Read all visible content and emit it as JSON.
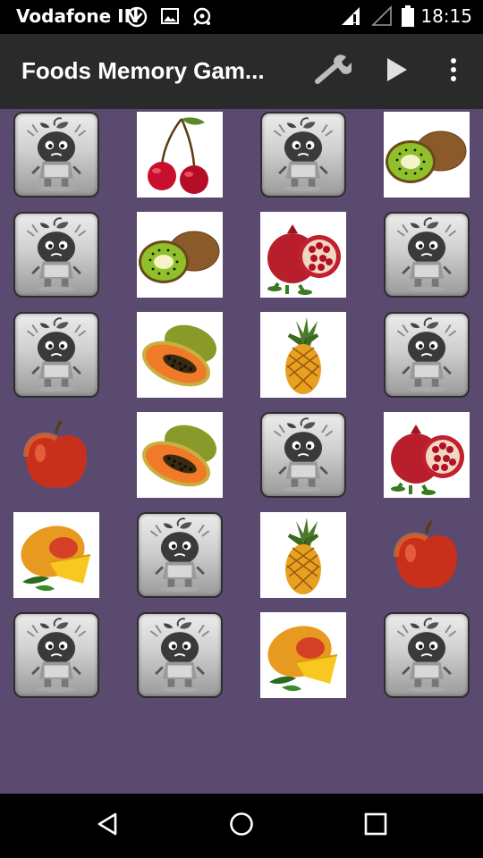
{
  "status_bar": {
    "carrier": "Vodafone IN",
    "time": "18:15"
  },
  "app_bar": {
    "title": "Foods Memory Gam...",
    "actions": [
      "wrench-icon",
      "play-icon",
      "overflow-menu-icon"
    ]
  },
  "board": {
    "background": "#5a4a70",
    "rows": [
      [
        "back",
        "cherry",
        "back",
        "kiwi"
      ],
      [
        "back",
        "kiwi",
        "pomegranate",
        "back"
      ],
      [
        "back",
        "papaya",
        "pineapple",
        "back"
      ],
      [
        "apple",
        "papaya",
        "back",
        "pomegranate"
      ],
      [
        "mango",
        "back",
        "pineapple",
        "apple"
      ],
      [
        "back",
        "back",
        "mango",
        "back"
      ]
    ]
  },
  "nav_bar": {
    "buttons": [
      "back-icon",
      "home-icon",
      "recents-icon"
    ]
  }
}
